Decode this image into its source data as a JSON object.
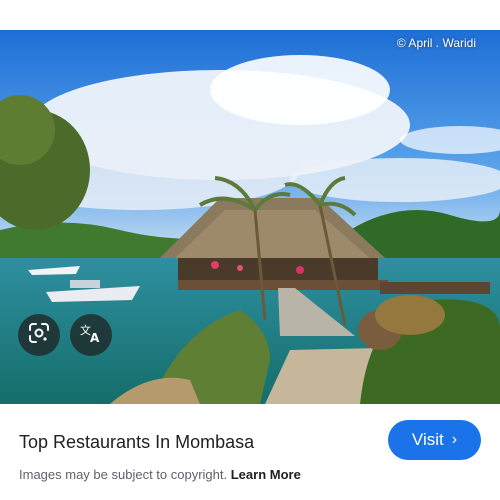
{
  "image": {
    "credit": "© April . Waridi"
  },
  "overlay_buttons": {
    "lens_icon": "google-lens-icon",
    "translate_icon": "translate-icon"
  },
  "result": {
    "title": "Top Restaurants In Mombasa",
    "visit_label": "Visit",
    "notice_text": "Images may be subject to copyright.",
    "learn_more": "Learn More"
  },
  "colors": {
    "accent": "#1a73e8",
    "title_text": "#202124"
  }
}
